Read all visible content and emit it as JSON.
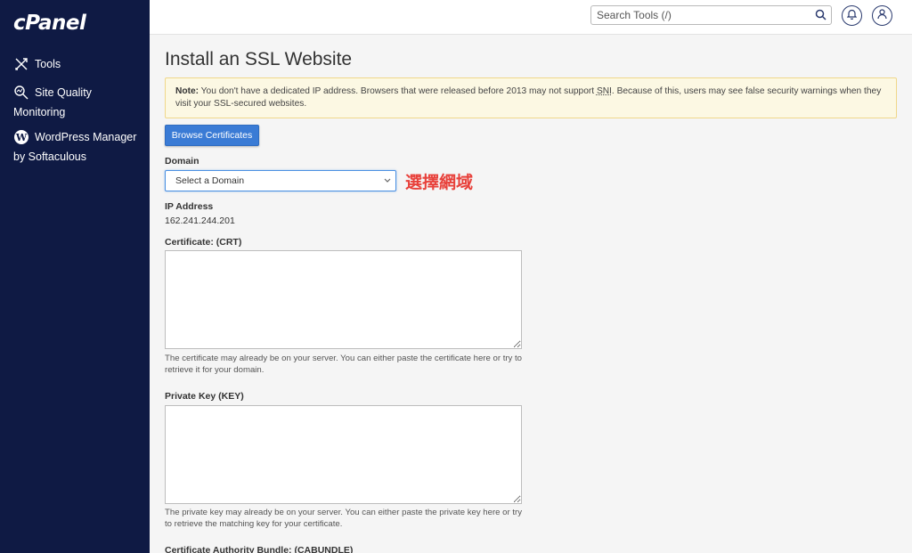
{
  "sidebar": {
    "logo": "cPanel",
    "items": [
      {
        "label_line1": "Tools",
        "label_line2": "",
        "icon": "tools-icon"
      },
      {
        "label_line1": "Site Quality",
        "label_line2": "Monitoring",
        "icon": "magnifier-icon"
      },
      {
        "label_line1": "WordPress Manager",
        "label_line2": "by Softaculous",
        "icon": "wordpress-icon"
      }
    ]
  },
  "header": {
    "search_placeholder": "Search Tools (/)",
    "bell_icon": "bell-icon",
    "user_icon": "user-icon"
  },
  "main": {
    "title": "Install an SSL Website",
    "alert": {
      "label": "Note:",
      "text_before": " You don't have a dedicated IP address. Browsers that were released before 2013 may not support ",
      "abbr": "SNI",
      "text_after": ". Because of this, users may see false security warnings when they visit your SSL-secured websites."
    },
    "browse_button": "Browse Certificates",
    "domain_label": "Domain",
    "domain_select": "Select a Domain",
    "annotation": "選擇網域",
    "ip_label": "IP Address",
    "ip_value": "162.241.244.201",
    "crt_label": "Certificate: (CRT)",
    "crt_help": "The certificate may already be on your server. You can either paste the certificate here or try to retrieve it for your domain.",
    "key_label": "Private Key (KEY)",
    "key_help": "The private key may already be on your server. You can either paste the private key here or try to retrieve the matching key for your certificate.",
    "cabundle_label": "Certificate Authority Bundle: (CABUNDLE)"
  },
  "colors": {
    "sidebar_bg": "#0f1a44",
    "primary_button": "#3a7bd5",
    "alert_bg": "#fcf8e3",
    "annotation": "#e8413b"
  }
}
